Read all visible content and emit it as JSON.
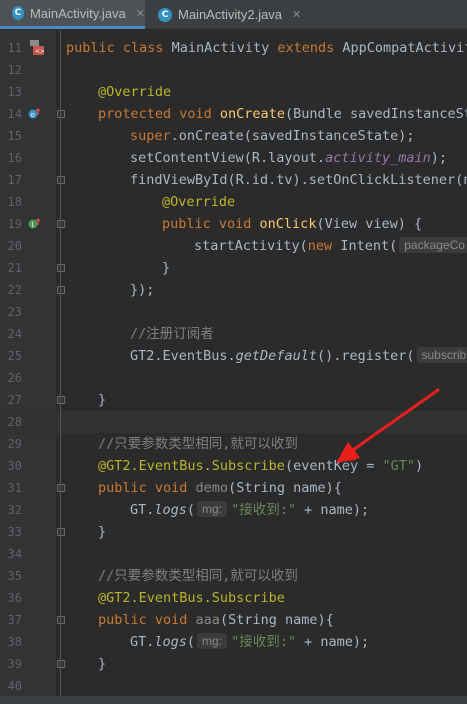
{
  "tabs": [
    {
      "label": "MainActivity.java",
      "icon": "c-class-icon",
      "active": true
    },
    {
      "label": "MainActivity2.java",
      "icon": "c-class-icon",
      "active": false
    }
  ],
  "close_glyph": "✕",
  "class_glyph": "C",
  "line_numbers": [
    "11",
    "12",
    "13",
    "14",
    "15",
    "16",
    "17",
    "18",
    "19",
    "20",
    "21",
    "22",
    "23",
    "24",
    "25",
    "26",
    "27",
    "28",
    "29",
    "30",
    "31",
    "32",
    "33",
    "34",
    "35",
    "36",
    "37",
    "38",
    "39",
    "40"
  ],
  "code": {
    "l11": {
      "kw1": "public class ",
      "name": "MainActivity ",
      "kw2": "extends ",
      "parent": "AppCompatActivit"
    },
    "l13": "@Override",
    "l14": {
      "kw": "protected void ",
      "fn": "onCreate",
      "rest": "(Bundle savedInstanceSt"
    },
    "l15": {
      "kw": "super",
      "rest": ".onCreate(savedInstanceState);"
    },
    "l16": {
      "pre": "setContentView(R.layout.",
      "field": "activity_main",
      "post": ");"
    },
    "l17": "findViewById(R.id.tv).setOnClickListener(n",
    "l18": "@Override",
    "l19": {
      "kw": "public void ",
      "fn": "onClick",
      "rest": "(View view) {"
    },
    "l20": {
      "pre": "startActivity(",
      "kw": "new ",
      "cls": "Intent(",
      "hint": "packageCo"
    },
    "l21": "}",
    "l22": "});",
    "l24": "//注册订阅者",
    "l25": {
      "pre": "GT2.EventBus.",
      "method": "getDefault",
      "post": "().register(",
      "hint": "subscrib"
    },
    "l27": "}",
    "l29": "//只要参数类型相同,就可以收到",
    "l30": {
      "ann": "@GT2.EventBus.Subscribe",
      "pre": "(eventKey = ",
      "str": "\"GT\"",
      "post": ")"
    },
    "l31": {
      "kw": "public void ",
      "fn": "demo",
      "rest": "(String name){"
    },
    "l32": {
      "pre": "GT.",
      "method": "logs",
      "post": "(",
      "hint": "mg:",
      "str": "\"接收到:\"",
      "tail": " + name);"
    },
    "l33": "}",
    "l35": "//只要参数类型相同,就可以收到",
    "l36": "@GT2.EventBus.Subscribe",
    "l37": {
      "kw": "public void ",
      "fn": "aaa",
      "rest": "(String name){"
    },
    "l38": {
      "pre": "GT.",
      "method": "logs",
      "post": "(",
      "hint": "mg:",
      "str": "\"接收到:\"",
      "tail": " + name);"
    },
    "l39": "}"
  },
  "colors": {
    "background": "#2b2b2b",
    "keyword": "#cc7832",
    "function": "#ffc66d",
    "annotation": "#bbb529",
    "string": "#6a8759",
    "comment": "#808080",
    "field": "#9876aa",
    "arrow": "#e8201c"
  }
}
